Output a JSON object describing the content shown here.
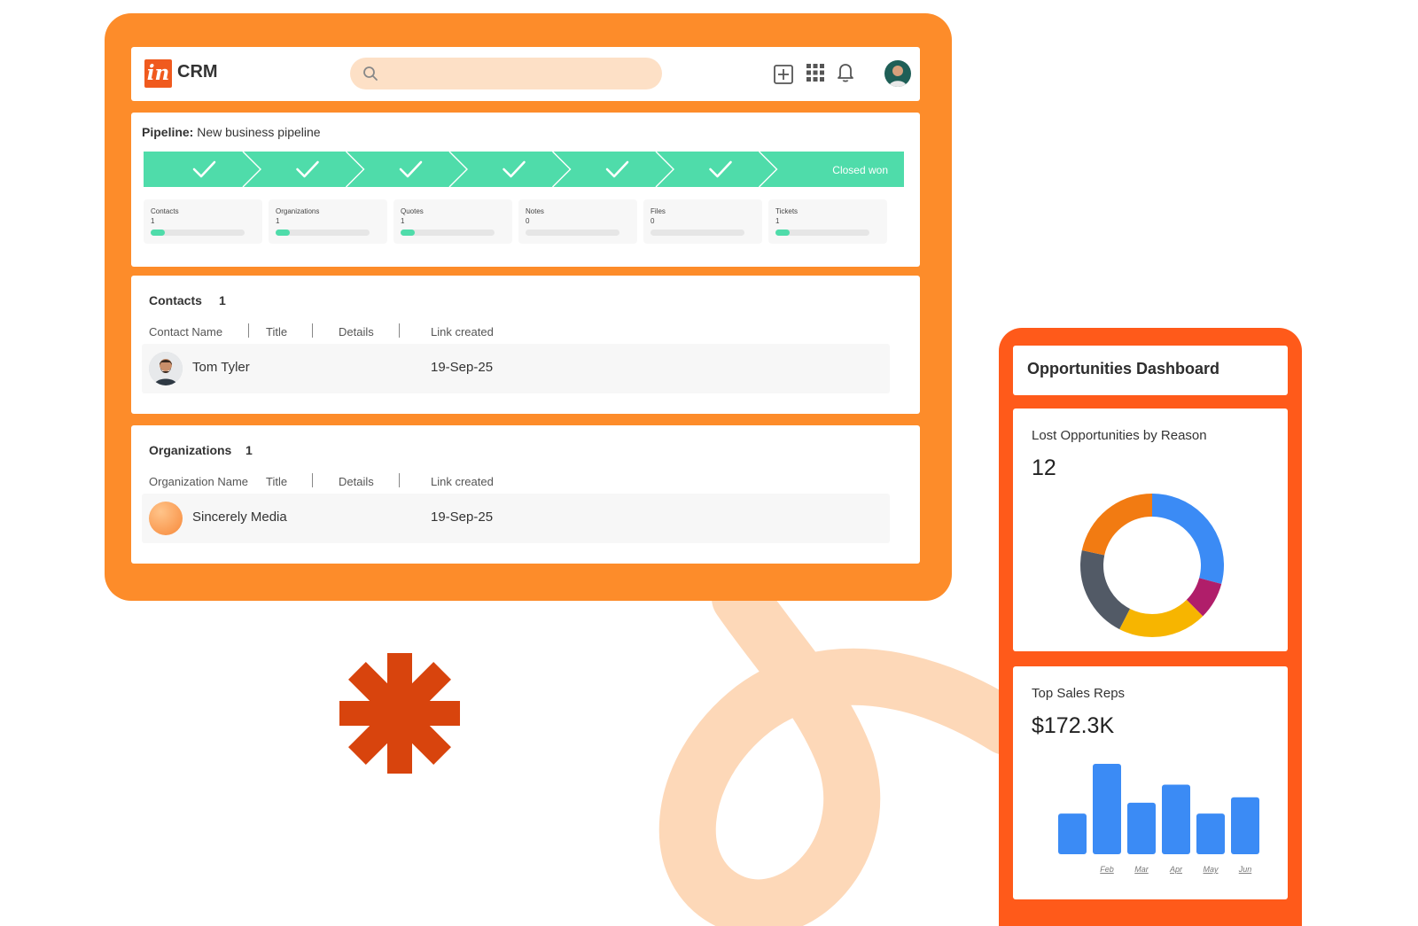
{
  "header": {
    "logo_mark": "in",
    "logo_text": "CRM",
    "search_placeholder": "",
    "icons": [
      "search-icon",
      "add-icon",
      "apps-grid-icon",
      "bell-icon",
      "user-avatar"
    ]
  },
  "pipeline": {
    "label": "Pipeline:",
    "name": "New business pipeline",
    "stages_completed": 6,
    "final_stage_label": "Closed won",
    "stats": [
      {
        "label": "Contacts",
        "value": "1",
        "progress": 0.15
      },
      {
        "label": "Organizations",
        "value": "1",
        "progress": 0.15
      },
      {
        "label": "Quotes",
        "value": "1",
        "progress": 0.15
      },
      {
        "label": "Notes",
        "value": "0",
        "progress": 0
      },
      {
        "label": "Files",
        "value": "0",
        "progress": 0
      },
      {
        "label": "Tickets",
        "value": "1",
        "progress": 0.15
      }
    ]
  },
  "contacts": {
    "title": "Contacts",
    "count": "1",
    "columns": [
      "Contact Name",
      "Title",
      "Details",
      "Link created"
    ],
    "rows": [
      {
        "name": "Tom Tyler",
        "date": "19-Sep-25"
      }
    ]
  },
  "organizations": {
    "title": "Organizations",
    "count": "1",
    "columns": [
      "Organization Name",
      "Title",
      "Details",
      "Link created"
    ],
    "rows": [
      {
        "name": "Sincerely Media",
        "date": "19-Sep-25"
      }
    ]
  },
  "dashboard": {
    "title": "Opportunities Dashboard",
    "lost": {
      "title": "Lost Opportunities by Reason",
      "value": "12"
    },
    "reps": {
      "title": "Top Sales Reps",
      "value": "$172.3K"
    }
  },
  "colors": {
    "brand_orange": "#fd8c2a",
    "dashboard_orange": "#ff5a1a",
    "pipeline_green": "#4fdcaa",
    "chart_blue": "#3b8bf5"
  },
  "chart_data": [
    {
      "type": "pie",
      "title": "Lost Opportunities by Reason",
      "categories": [
        "",
        "",
        "",
        "",
        ""
      ],
      "values": [
        3.5,
        1.0,
        2.4,
        2.5,
        2.6
      ],
      "colors": [
        "#3b8bf5",
        "#b01e6a",
        "#f7b500",
        "#525a66",
        "#f27b12"
      ]
    },
    {
      "type": "bar",
      "title": "Top Sales Reps",
      "categories": [
        "",
        "Feb",
        "Mar",
        "Apr",
        "May",
        "Jun"
      ],
      "values": [
        45,
        100,
        57,
        77,
        45,
        63
      ],
      "color": "#3b8bf5"
    }
  ]
}
